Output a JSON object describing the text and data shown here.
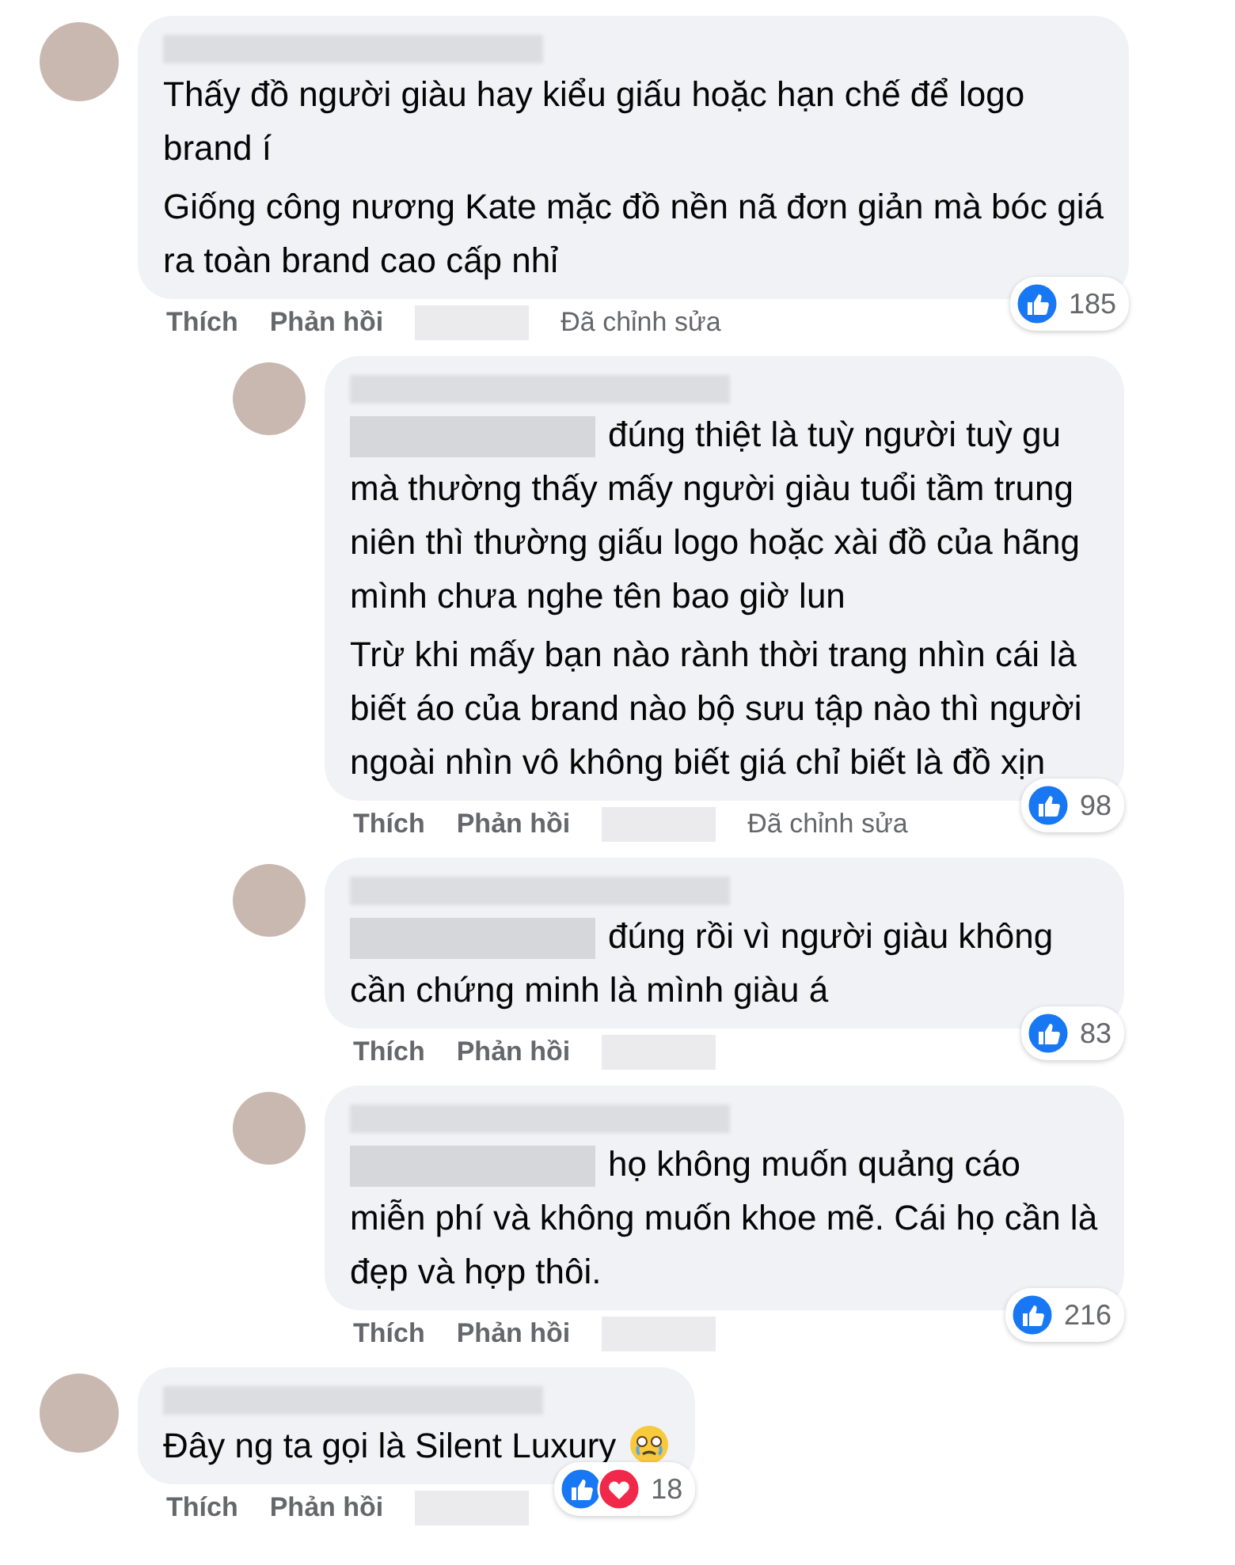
{
  "comments": [
    {
      "paragraphs": [
        "Thấy đồ người giàu hay kiểu giấu hoặc hạn chế để logo brand í",
        "Giống công nương Kate mặc đồ nền nã đơn giản mà bóc giá ra toàn brand cao cấp nhỉ"
      ],
      "mention": false,
      "emoji_after": false,
      "reactions": [
        {
          "kind": "like"
        }
      ],
      "reaction_count": "185",
      "actions": [
        "Thích",
        "Phản hồi"
      ],
      "edited_label": "Đã chỉnh sửa",
      "children": [
        {
          "paragraphs": [
            "đúng thiệt là tuỳ người tuỳ gu mà thường thấy mấy người giàu tuổi tầm trung niên thì thường giấu logo hoặc xài đồ của hãng mình chưa nghe tên bao giờ lun",
            "Trừ khi mấy bạn nào rành thời trang nhìn cái là biết áo của brand nào bộ sưu tập nào thì người ngoài nhìn vô không biết giá chỉ biết là đồ xịn"
          ],
          "mention": true,
          "emoji_after": false,
          "reactions": [
            {
              "kind": "like"
            }
          ],
          "reaction_count": "98",
          "actions": [
            "Thích",
            "Phản hồi"
          ],
          "edited_label": "Đã chỉnh sửa"
        },
        {
          "paragraphs": [
            "đúng rồi vì người giàu không cần chứng minh là mình giàu á"
          ],
          "mention": true,
          "emoji_after": false,
          "reactions": [
            {
              "kind": "like"
            }
          ],
          "reaction_count": "83",
          "actions": [
            "Thích",
            "Phản hồi"
          ]
        },
        {
          "paragraphs": [
            "họ không muốn quảng cáo miễn phí và không muốn khoe mẽ. Cái họ cần là đẹp và hợp thôi."
          ],
          "mention": true,
          "emoji_after": false,
          "reactions": [
            {
              "kind": "like"
            }
          ],
          "reaction_count": "216",
          "actions": [
            "Thích",
            "Phản hồi"
          ]
        }
      ]
    },
    {
      "paragraphs": [
        "Đây ng ta gọi là Silent Luxury"
      ],
      "mention": false,
      "emoji_after": true,
      "reactions": [
        {
          "kind": "like"
        },
        {
          "kind": "love"
        }
      ],
      "reaction_count": "18",
      "actions": [
        "Thích",
        "Phản hồi"
      ]
    }
  ]
}
